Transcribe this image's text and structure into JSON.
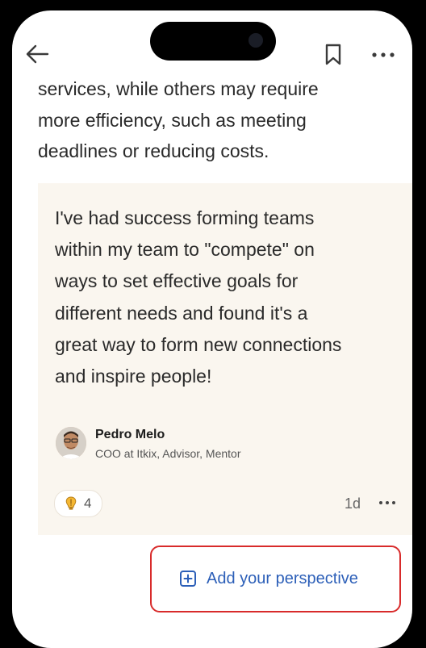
{
  "header": {
    "back_icon": "arrow-left-icon",
    "bookmark_icon": "bookmark-icon",
    "more_icon": "more-horizontal-icon"
  },
  "article": {
    "lines": [
      "services, while others may require",
      "more efficiency, such as meeting",
      "deadlines or reducing costs."
    ]
  },
  "comment": {
    "lines": [
      "I've had success forming teams",
      "within my team to \"compete\" on",
      "ways to set effective goals for",
      "different needs and found it's a",
      "great way to form new connections",
      "and inspire people!"
    ],
    "author_name": "Pedro Melo",
    "author_title": "COO at Itkix, Advisor, Mentor",
    "reaction_icon": "insightful-lightbulb-icon",
    "reaction_count": "4",
    "timestamp": "1d",
    "more_icon": "more-horizontal-icon"
  },
  "cta": {
    "label": "Add your perspective",
    "icon": "plus-square-icon"
  },
  "colors": {
    "accent": "#2c5fb8",
    "card_background": "#faf6ef",
    "highlight_border": "#d82b2b"
  }
}
